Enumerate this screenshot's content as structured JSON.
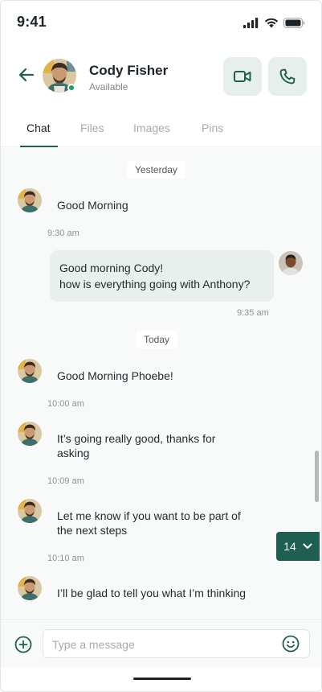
{
  "status_bar": {
    "time": "9:41"
  },
  "header": {
    "contact_name": "Cody Fisher",
    "contact_status": "Available",
    "icons": {
      "back": "arrow-left-icon",
      "video": "video-camera-icon",
      "call": "phone-icon"
    }
  },
  "tabs": [
    {
      "label": "Chat",
      "active": true
    },
    {
      "label": "Files",
      "active": false
    },
    {
      "label": "Images",
      "active": false
    },
    {
      "label": "Pins",
      "active": false
    }
  ],
  "chat": {
    "day_labels": [
      "Yesterday",
      "Today"
    ],
    "messages": [
      {
        "direction": "in",
        "text": "Good Morning",
        "time": "9:30 am"
      },
      {
        "direction": "out",
        "line1": "Good morning Cody!",
        "line2": "how is everything going with Anthony?",
        "time": "9:35 am"
      },
      {
        "direction": "in",
        "text": "Good Morning Phoebe!",
        "time": "10:00 am"
      },
      {
        "direction": "in",
        "line1": "It’s going really good, thanks for",
        "line2": "asking",
        "time": "10:09 am"
      },
      {
        "direction": "in",
        "line1": "Let me know if you want to be part of",
        "line2": "the next steps",
        "time": "10:10 am"
      },
      {
        "direction": "in",
        "text": "I’ll be glad to tell you what I’m thinking",
        "time": ""
      }
    ],
    "unread_count": "14"
  },
  "composer": {
    "placeholder": "Type a message"
  },
  "colors": {
    "accent": "#1f5f52",
    "online": "#1f9d5b",
    "button_bg": "#e7efec",
    "bubble_out": "#e8efed"
  }
}
